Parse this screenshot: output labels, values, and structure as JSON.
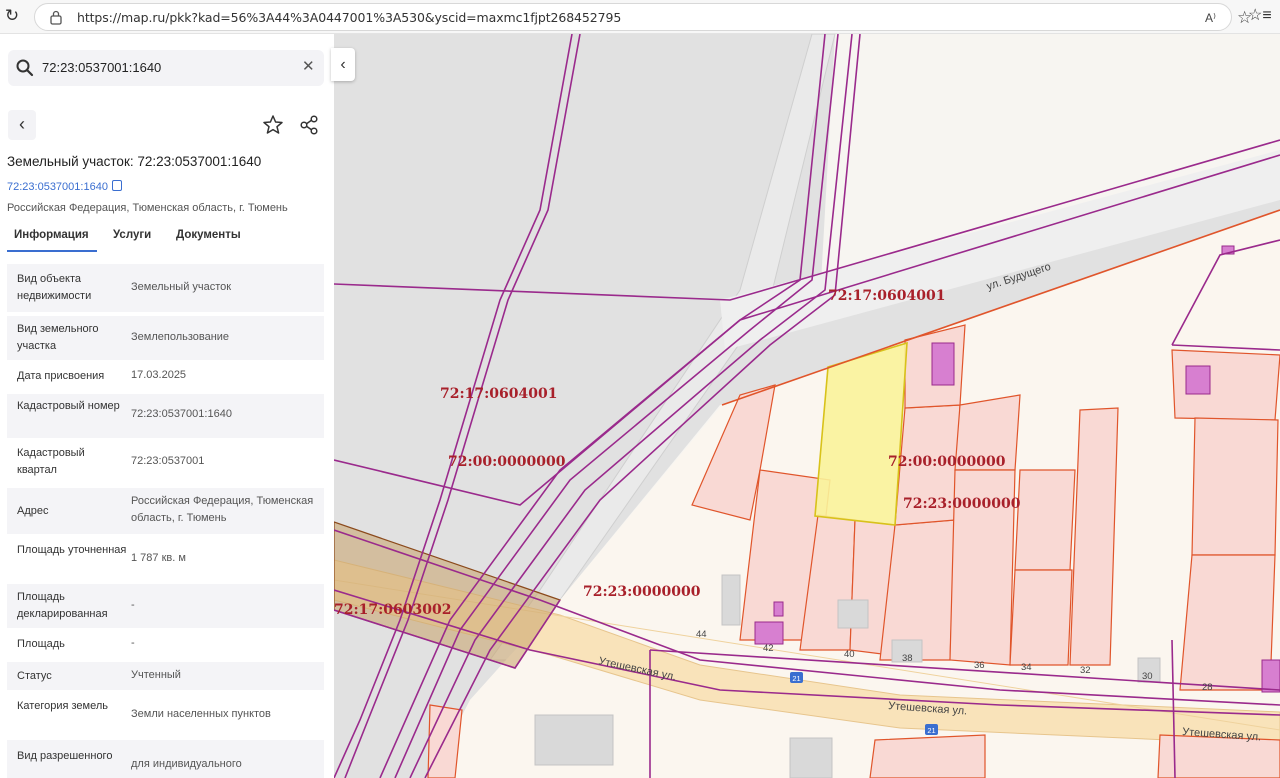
{
  "browser": {
    "url": "https://map.ru/pkk?kad=56%3A44%3A0447001%3A530&yscid=maxmc1fjpt268452795",
    "read_aloud_icon": "A⁾"
  },
  "search": {
    "value": "72:23:0537001:1640"
  },
  "object": {
    "title": "Земельный участок: 72:23:0537001:1640",
    "number": "72:23:0537001:1640",
    "address": "Российская Федерация, Тюменская область, г. Тюмень"
  },
  "tabs": [
    {
      "label": "Информация",
      "active": true
    },
    {
      "label": "Услуги",
      "active": false
    },
    {
      "label": "Документы",
      "active": false
    }
  ],
  "info": [
    {
      "label": "Вид объекта недвижимости",
      "value": "Земельный участок"
    },
    {
      "label": "Вид земельного участка",
      "value": "Землепользование"
    },
    {
      "label": "Дата присвоения",
      "value": "17.03.2025"
    },
    {
      "label": "Кадастровый номер",
      "value": "72:23:0537001:1640"
    },
    {
      "label": "Кадастровый квартал",
      "value": "72:23:0537001"
    },
    {
      "label": "Адрес",
      "value": "Российская Федерация, Тюменская область, г. Тюмень"
    },
    {
      "label": "Площадь уточненная",
      "value": "1 787 кв. м"
    },
    {
      "label": "Площадь декларированная",
      "value": "-"
    },
    {
      "label": "Площадь",
      "value": "-"
    },
    {
      "label": "Статус",
      "value": "Учтенный"
    },
    {
      "label": "Категория земель",
      "value": "Земли населенных пунктов"
    },
    {
      "label": "Вид разрешенного",
      "value": "для индивидуального"
    }
  ],
  "map": {
    "cadastral_labels": [
      "72:17:0604001",
      "72:17:0604001",
      "72:00:0000000",
      "72:00:0000000",
      "72:23:0000000",
      "72:23:0000000",
      "72:17:0603002"
    ],
    "streets": [
      "ул. Будущего",
      "Утешевская ул.",
      "Утешевская ул.",
      "Утешевская ул."
    ],
    "house_numbers": [
      "44",
      "42",
      "40",
      "38",
      "36",
      "34",
      "32",
      "30",
      "28"
    ],
    "route_badge": "21",
    "colors": {
      "boundary": "#9a2a8c",
      "parcel_fill": "#f9d9d4",
      "parcel_stroke": "#e0552b",
      "selected_fill": "#faf39a",
      "selected_stroke": "#d8c21a",
      "building": "#d77fd0",
      "gray_area": "#e1e1e1",
      "road": "#f9e3ba"
    }
  }
}
